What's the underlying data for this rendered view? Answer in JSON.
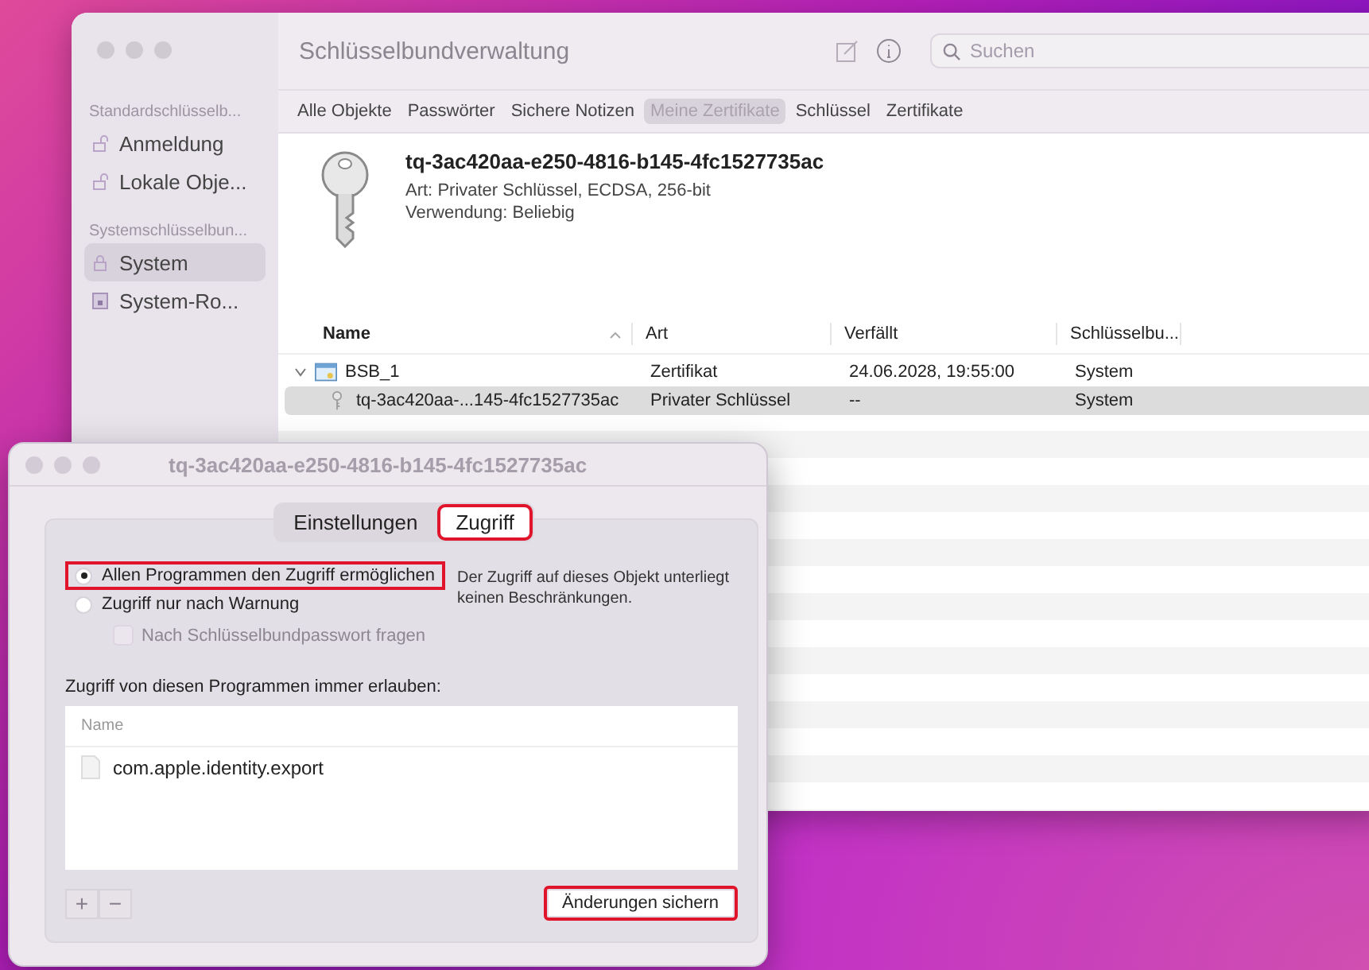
{
  "window": {
    "title": "Schlüsselbundverwaltung"
  },
  "search": {
    "placeholder": "Suchen"
  },
  "sidebar": {
    "sections": [
      {
        "heading": "Standardschlüsselb...",
        "items": [
          {
            "label": "Anmeldung",
            "kind": "lock-open",
            "selected": false
          },
          {
            "label": "Lokale Obje...",
            "kind": "lock-open",
            "selected": false
          }
        ]
      },
      {
        "heading": "Systemschlüsselbun...",
        "items": [
          {
            "label": "System",
            "kind": "lock",
            "selected": true
          },
          {
            "label": "System-Ro...",
            "kind": "cabinet",
            "selected": false
          }
        ]
      }
    ]
  },
  "categories": [
    {
      "label": "Alle Objekte",
      "selected": false
    },
    {
      "label": "Passwörter",
      "selected": false
    },
    {
      "label": "Sichere Notizen",
      "selected": false
    },
    {
      "label": "Meine Zertifikate",
      "selected": true
    },
    {
      "label": "Schlüssel",
      "selected": false
    },
    {
      "label": "Zertifikate",
      "selected": false
    }
  ],
  "detail": {
    "name": "tq-3ac420aa-e250-4816-b145-4fc1527735ac",
    "lines": [
      {
        "label": "Art:",
        "value": "Privater Schlüssel, ECDSA, 256-bit"
      },
      {
        "label": "Verwendung:",
        "value": "Beliebig"
      }
    ]
  },
  "table": {
    "columns": [
      "Name",
      "Art",
      "Verfällt",
      "Schlüsselbu..."
    ],
    "rows": [
      {
        "kind": "certificate",
        "expanded": true,
        "selected": false,
        "cells": [
          "BSB_1",
          "Zertifikat",
          "24.06.2028, 19:55:00",
          "System"
        ],
        "children": [
          {
            "kind": "key",
            "selected": true,
            "cells": [
              "tq-3ac420aa-...145-4fc1527735ac",
              "Privater Schlüssel",
              "--",
              "System"
            ]
          }
        ]
      }
    ]
  },
  "dialog": {
    "title": "tq-3ac420aa-e250-4816-b145-4fc1527735ac",
    "tabs": [
      {
        "label": "Einstellungen",
        "selected": false,
        "highlighted": false
      },
      {
        "label": "Zugriff",
        "selected": true,
        "highlighted": true
      }
    ],
    "options": [
      {
        "label": "Allen Programmen den Zugriff ermöglichen",
        "selected": true,
        "highlighted": true
      },
      {
        "label": "Zugriff nur nach Warnung",
        "selected": false,
        "highlighted": false
      }
    ],
    "password_prompt": {
      "label": "Nach Schlüsselbundpasswort fragen",
      "checked": false,
      "disabled": true
    },
    "description": "Der Zugriff auf dieses Objekt unterliegt keinen Beschränkungen.",
    "apps_label": "Zugriff von diesen Programmen immer erlauben:",
    "apps_column": "Name",
    "apps": [
      "com.apple.identity.export"
    ],
    "add_label": "+",
    "remove_label": "−",
    "save_button": {
      "label": "Änderungen sichern",
      "highlighted": true
    }
  }
}
